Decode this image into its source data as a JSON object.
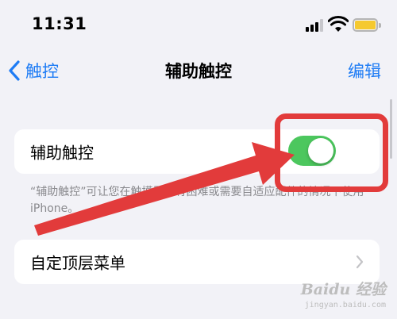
{
  "status_bar": {
    "time": "11:31",
    "battery_color": "#f5c92f"
  },
  "nav": {
    "back_label": "触控",
    "title": "辅助触控",
    "edit_label": "编辑"
  },
  "assistive_touch": {
    "label": "辅助触控",
    "enabled": true,
    "description": "“辅助触控”可让您在触摸屏幕有困难或需要自适应配件的情况下使用iPhone。"
  },
  "custom_menu": {
    "label": "自定顶层菜单"
  },
  "annotation": {
    "color": "#e23b3b"
  },
  "colors": {
    "accent": "#1e7cf5",
    "switch_on": "#4cc75e",
    "background": "#f2f2f7"
  },
  "watermark": {
    "logo": "Baidu 经验",
    "url": "jingyan.baidu.com"
  }
}
